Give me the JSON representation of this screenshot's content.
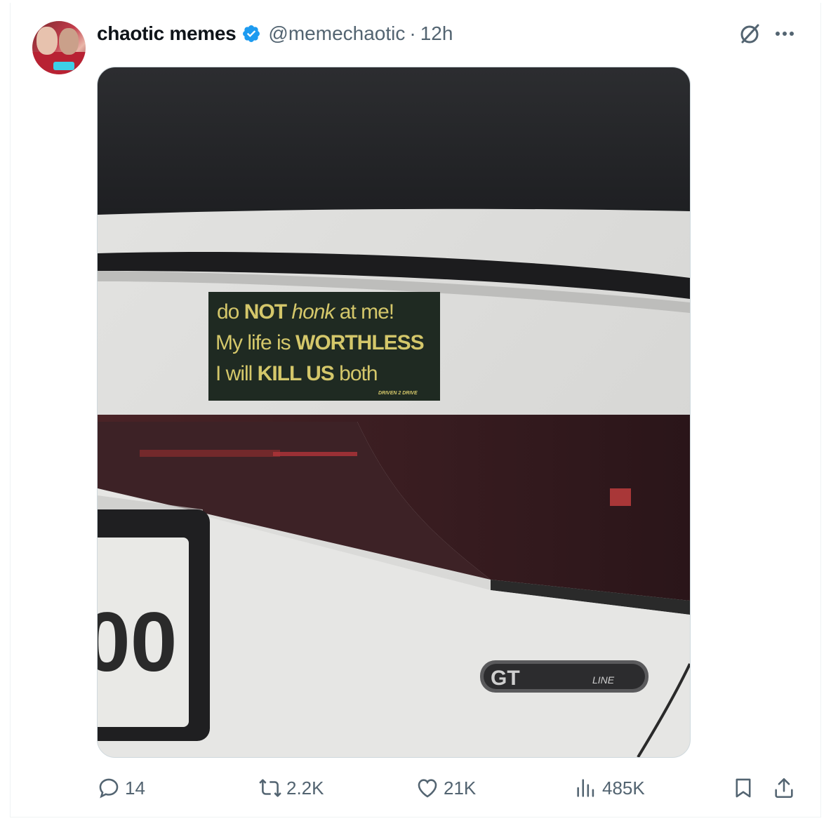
{
  "post": {
    "author_name": "chaotic memes",
    "handle": "@memechaotic",
    "separator": "·",
    "time": "12h",
    "verified": true
  },
  "media": {
    "sticker_line1_a": "do ",
    "sticker_line1_b": "NOT",
    "sticker_line1_c": " honk",
    "sticker_line1_d": " at me!",
    "sticker_line2_a": "My life is ",
    "sticker_line2_b": "WORTHLESS",
    "sticker_line3_a": "I will ",
    "sticker_line3_b": "KILL US",
    "sticker_line3_c": " both",
    "sticker_brand": "DRIVEN 2 DRIVE",
    "plate_digits": "00",
    "badge_text": "LINE",
    "badge_logo": "GT"
  },
  "actions": {
    "replies": "14",
    "reposts": "2.2K",
    "likes": "21K",
    "views": "485K"
  },
  "colors": {
    "verified": "#1d9bf0",
    "text_secondary": "#536471",
    "sticker_bg": "#1f2a22",
    "sticker_text": "#d4c76a"
  }
}
